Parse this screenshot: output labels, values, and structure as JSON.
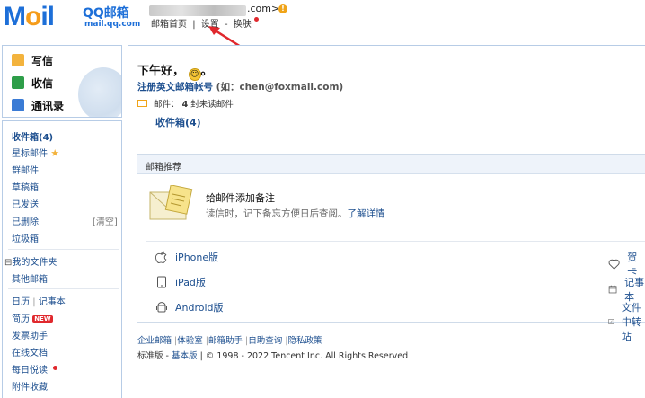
{
  "brand": {
    "logo_m": "M",
    "logo_o": "o",
    "logo_il": "il",
    "qq_text": "QQ邮箱",
    "url_text": "mail.qq.com",
    "logo_icon": "qq-mail-logo"
  },
  "account": {
    "suffix": ".com>",
    "alert_icon": "exclamation-icon",
    "alert_glyph": "!"
  },
  "topnav": {
    "home": "邮箱首页",
    "sep": "|",
    "settings": "设置",
    "dash": "-",
    "skin": "换肤"
  },
  "left_top": {
    "items": [
      {
        "label": "写信",
        "icon": "write-icon",
        "color": "#f3b33d"
      },
      {
        "label": "收信",
        "icon": "receive-icon",
        "color": "#2e9e49"
      },
      {
        "label": "通讯录",
        "icon": "contacts-icon",
        "color": "#3a7bd5"
      }
    ]
  },
  "left_nav": {
    "inbox": "收件箱(4)",
    "starred": "星标邮件",
    "groups": "群邮件",
    "drafts": "草稿箱",
    "sent": "已发送",
    "deleted": "已删除",
    "clear": "[清空]",
    "spam": "垃圾箱",
    "my_folders": "我的文件夹",
    "folders_toggle": "⊟",
    "other_mail": "其他邮箱",
    "calendar": "日历",
    "notes": "记事本",
    "resume": "简历",
    "new_badge": "NEW",
    "mail_helper": "发票助手",
    "online_docs": "在线文档",
    "daily_reads": "每日悦读",
    "attachments": "附件收藏"
  },
  "main": {
    "greeting": "下午好，",
    "greeting_end": "。",
    "greeting_icon": "smile-emoji-icon",
    "register_alias": "注册英文邮箱帐号",
    "register_hint": "(如：chen@foxmail.com)",
    "mail_label": "邮件：",
    "unread_count": "4",
    "unread_suffix": "封未读邮件",
    "inbox_link": "收件箱(4)"
  },
  "recommend": {
    "title": "邮箱推荐",
    "feature_title": "给邮件添加备注",
    "feature_desc": "读信时，记下备忘方便日后查阅。",
    "feature_link": "了解详情",
    "apps": [
      {
        "label": "iPhone版",
        "icon": "apple-icon"
      },
      {
        "label": "iPad版",
        "icon": "tablet-icon"
      },
      {
        "label": "Android版",
        "icon": "android-icon"
      }
    ],
    "right_apps": [
      {
        "label": "贺卡",
        "icon": "heart-icon"
      },
      {
        "label": "记事本",
        "icon": "calendar-icon"
      },
      {
        "label": "文件中转站",
        "icon": "file-icon"
      }
    ]
  },
  "footer": {
    "links": [
      "企业邮箱",
      "体验室",
      "邮箱助手",
      "自助查询",
      "隐私政策"
    ],
    "version_standard": "标准版",
    "version_basic": "基本版",
    "copyright": "© 1998 - 2022 Tencent Inc. All Rights Reserved"
  },
  "colors": {
    "link": "#1d4f8f",
    "border": "#b7cce6",
    "accent_red": "#e0282d"
  }
}
